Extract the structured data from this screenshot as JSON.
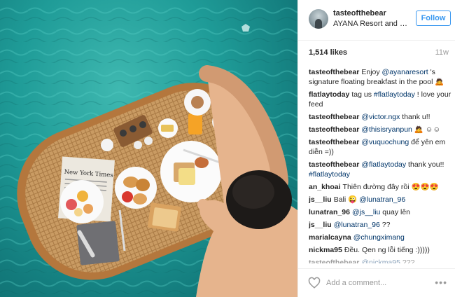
{
  "post": {
    "username": "tasteofthebear",
    "location": "AYANA Resort and S...",
    "follow_label": "Follow",
    "likes": "1,514 likes",
    "time": "11w"
  },
  "photo": {
    "newspaper_text": "New York Times",
    "description_icon": "floating-breakfast-photo"
  },
  "comments": [
    {
      "user": "tasteofthebear",
      "parts": [
        {
          "t": "Enjoy "
        },
        {
          "t": "@ayanaresort",
          "m": true
        },
        {
          "t": " 's signature floating breakfast in the pool 🙇"
        }
      ]
    },
    {
      "user": "flatlaytoday",
      "parts": [
        {
          "t": "tag us "
        },
        {
          "t": "#flatlaytoday",
          "m": true
        },
        {
          "t": " ! love your feed"
        }
      ]
    },
    {
      "user": "tasteofthebear",
      "parts": [
        {
          "t": "@victor.ngx",
          "m": true
        },
        {
          "t": " thank u!!"
        }
      ]
    },
    {
      "user": "tasteofthebear",
      "parts": [
        {
          "t": "@thisisryanpun",
          "m": true
        },
        {
          "t": " 🙇 ☺☺"
        }
      ]
    },
    {
      "user": "tasteofthebear",
      "parts": [
        {
          "t": "@vuquochung",
          "m": true
        },
        {
          "t": " để yên em diễn =))"
        }
      ]
    },
    {
      "user": "tasteofthebear",
      "parts": [
        {
          "t": "@flatlaytoday",
          "m": true
        },
        {
          "t": " thank you!! "
        },
        {
          "t": "#flatlaytoday",
          "m": true
        }
      ]
    },
    {
      "user": "an_khoai",
      "parts": [
        {
          "t": "Thiên đường đây rồi 😍😍😍"
        }
      ]
    },
    {
      "user": "js__liu",
      "parts": [
        {
          "t": "Bali 😜 "
        },
        {
          "t": "@lunatran_96",
          "m": true
        }
      ]
    },
    {
      "user": "lunatran_96",
      "parts": [
        {
          "t": "@js__liu",
          "m": true
        },
        {
          "t": " quay lên"
        }
      ]
    },
    {
      "user": "js__liu",
      "parts": [
        {
          "t": "@lunatran_96",
          "m": true
        },
        {
          "t": " ??"
        }
      ]
    },
    {
      "user": "marialcayna",
      "parts": [
        {
          "t": "@chungximang",
          "m": true
        }
      ]
    },
    {
      "user": "nickma95",
      "parts": [
        {
          "t": "Đều. Qen ng lỗi tiếng :)))))"
        }
      ]
    },
    {
      "user": "tasteofthebear",
      "parts": [
        {
          "t": "@nickma95",
          "m": true
        },
        {
          "t": " ??? "
        }
      ],
      "faded": true
    }
  ],
  "add_comment": {
    "placeholder": "Add a comment..."
  },
  "icons": {
    "like": "heart-icon",
    "more": "more-options-icon"
  },
  "colors": {
    "accent": "#3897f0",
    "mention": "#003569",
    "water": "#1f9c98"
  }
}
